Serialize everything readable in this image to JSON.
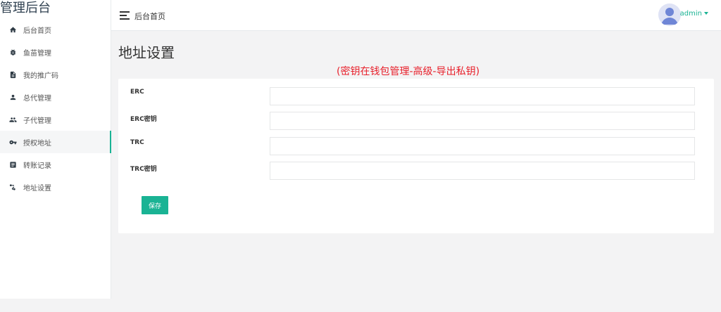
{
  "brand": {
    "title": "管理后台"
  },
  "sidebar": {
    "items": [
      {
        "label": "后台首页",
        "icon": "home-icon"
      },
      {
        "label": "鱼苗管理",
        "icon": "bug-icon"
      },
      {
        "label": "我的推广码",
        "icon": "document-icon"
      },
      {
        "label": "总代管理",
        "icon": "person-icon"
      },
      {
        "label": "子代管理",
        "icon": "people-icon"
      },
      {
        "label": "授权地址",
        "icon": "key-icon",
        "active": true
      },
      {
        "label": "转账记录",
        "icon": "list-icon"
      },
      {
        "label": "地址设置",
        "icon": "keys-icon"
      }
    ]
  },
  "topbar": {
    "breadcrumb": "后台首页",
    "user": "admin"
  },
  "main": {
    "title": "地址设置",
    "note": "(密钥在钱包管理-高级-导出私钥)",
    "fields": [
      {
        "label": "ERC",
        "value": ""
      },
      {
        "label": "ERC密钥",
        "value": ""
      },
      {
        "label": "TRC",
        "value": ""
      },
      {
        "label": "TRC密钥",
        "value": ""
      }
    ],
    "save_label": "保存"
  },
  "colors": {
    "accent": "#1ab394",
    "note": "#e8202b",
    "background": "#f3f3f4"
  }
}
